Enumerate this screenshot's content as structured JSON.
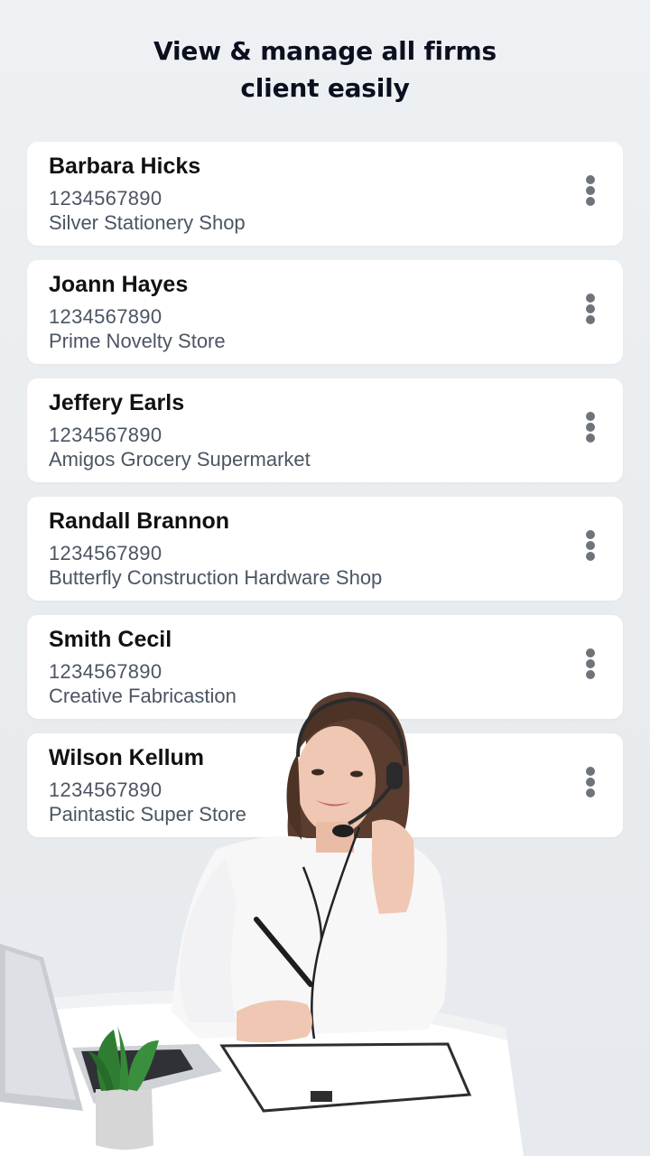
{
  "headline": {
    "line1": "View & manage all firms",
    "line2": "client easily"
  },
  "clients": [
    {
      "name": "Barbara Hicks",
      "phone": "1234567890",
      "firm": "Silver Stationery Shop"
    },
    {
      "name": "Joann Hayes",
      "phone": "1234567890",
      "firm": "Prime Novelty Store"
    },
    {
      "name": "Jeffery Earls",
      "phone": "1234567890",
      "firm": "Amigos Grocery Supermarket"
    },
    {
      "name": "Randall Brannon",
      "phone": "1234567890",
      "firm": "Butterfly Construction Hardware Shop"
    },
    {
      "name": "Smith Cecil",
      "phone": "1234567890",
      "firm": "Creative Fabricastion"
    },
    {
      "name": "Wilson Kellum",
      "phone": "1234567890",
      "firm": "Paintastic Super Store"
    }
  ],
  "icons": {
    "more": "more-vertical-icon"
  },
  "colors": {
    "background": "#eceff2",
    "card": "#ffffff",
    "headline": "#0b0f1e",
    "name": "#111111",
    "secondary_text": "#4b5563",
    "menu_dots": "#6f737a"
  }
}
